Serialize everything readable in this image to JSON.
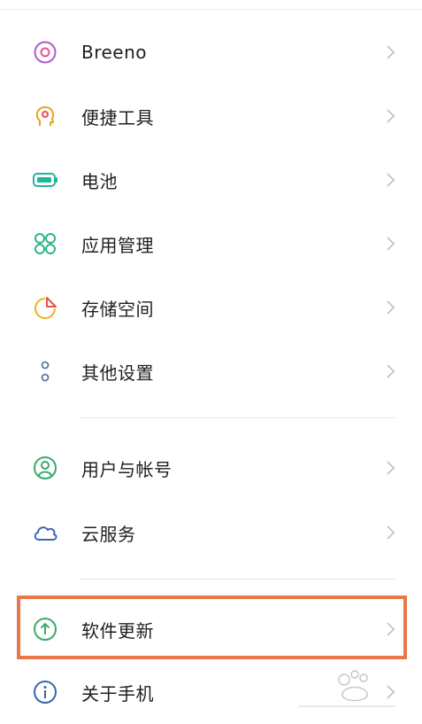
{
  "settings": {
    "items": [
      {
        "label": "Breeno",
        "icon": "breeno-icon",
        "color": "#b05cc8"
      },
      {
        "label": "便捷工具",
        "icon": "quick-tools-icon",
        "color": "#f0a020"
      },
      {
        "label": "电池",
        "icon": "battery-icon",
        "color": "#1fb59a"
      },
      {
        "label": "应用管理",
        "icon": "app-management-icon",
        "color": "#2fb58a"
      },
      {
        "label": "存储空间",
        "icon": "storage-icon",
        "color": "#f0b020"
      },
      {
        "label": "其他设置",
        "icon": "other-settings-icon",
        "color": "#5a78a8"
      },
      {
        "label": "用户与帐号",
        "icon": "user-account-icon",
        "color": "#3aaa6a"
      },
      {
        "label": "云服务",
        "icon": "cloud-service-icon",
        "color": "#3a64b4"
      },
      {
        "label": "软件更新",
        "icon": "software-update-icon",
        "color": "#3aaa6a"
      },
      {
        "label": "关于手机",
        "icon": "about-phone-icon",
        "color": "#3a64b4"
      }
    ]
  },
  "highlight": {
    "color": "#e8784a"
  }
}
